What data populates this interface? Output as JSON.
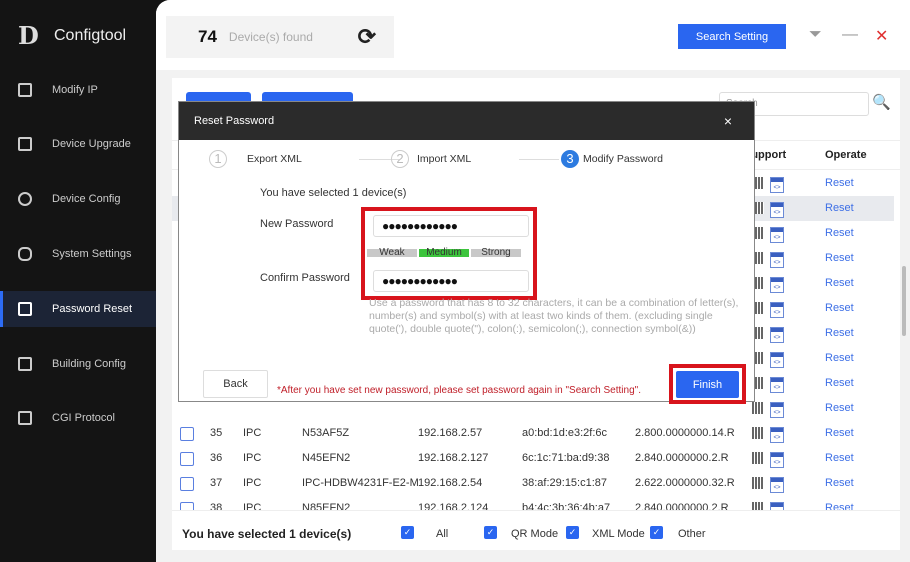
{
  "app": {
    "name": "Configtool"
  },
  "sidebar": {
    "items": [
      {
        "label": "Modify IP",
        "icon": "modify-ip-icon"
      },
      {
        "label": "Device Upgrade",
        "icon": "upgrade-icon"
      },
      {
        "label": "Device Config",
        "icon": "config-icon"
      },
      {
        "label": "System Settings",
        "icon": "settings-icon"
      },
      {
        "label": "Password Reset",
        "icon": "lock-icon",
        "active": true
      },
      {
        "label": "Building Config",
        "icon": "building-icon"
      },
      {
        "label": "CGI Protocol",
        "icon": "cgi-icon"
      }
    ]
  },
  "topbar": {
    "count": "74",
    "count_label": "Device(s) found",
    "search_setting": "Search Setting",
    "refresh": "⟳",
    "filter": "⏷",
    "minimize": "—",
    "close": "✕"
  },
  "table": {
    "search_placeholder": "Search",
    "headers": {
      "support": "Support",
      "operate": "Operate"
    },
    "reset_label": "Reset",
    "rows": [
      {
        "no": "35",
        "type": "IPC",
        "model": "N53AF5Z",
        "ip": "192.168.2.57",
        "mac": "a0:bd:1d:e3:2f:6c",
        "version": "2.800.0000000.14.R"
      },
      {
        "no": "36",
        "type": "IPC",
        "model": "N45EFN2",
        "ip": "192.168.2.127",
        "mac": "6c:1c:71:ba:d9:38",
        "version": "2.840.0000000.2.R"
      },
      {
        "no": "37",
        "type": "IPC",
        "model": "IPC-HDBW4231F-E2-M",
        "ip": "192.168.2.54",
        "mac": "38:af:29:15:c1:87",
        "version": "2.622.0000000.32.R"
      },
      {
        "no": "38",
        "type": "IPC",
        "model": "N85EFN2",
        "ip": "192.168.2.124",
        "mac": "b4:4c:3b:36:4b:a7",
        "version": "2.840.0000000.2.R"
      }
    ]
  },
  "bottom": {
    "selected": "You have selected 1  device(s)",
    "filters": [
      "All",
      "QR Mode",
      "XML Mode",
      "Other"
    ]
  },
  "dialog": {
    "title": "Reset Password",
    "close": "×",
    "steps": [
      {
        "n": "1",
        "label": "Export XML"
      },
      {
        "n": "2",
        "label": "Import XML"
      },
      {
        "n": "3",
        "label": "Modify Password",
        "active": true
      }
    ],
    "selected": "You have selected 1 device(s)",
    "new_password_label": "New Password",
    "new_password_value": "●●●●●●●●●●●●",
    "confirm_password_label": "Confirm Password",
    "confirm_password_value": "●●●●●●●●●●●●",
    "strength": {
      "levels": [
        "Weak",
        "Medium",
        "Strong"
      ],
      "current": "Medium",
      "color": "#3cc43c"
    },
    "hint": "Use a password that has 8 to 32 characters, it can be a combination of letter(s), number(s) and symbol(s) with at least two kinds of them. (excluding single quote('), double quote(\"), colon(:), semicolon(;), connection symbol(&))",
    "back": "Back",
    "warning": "*After you have set new password, please set password again in \"Search Setting\".",
    "finish": "Finish"
  }
}
